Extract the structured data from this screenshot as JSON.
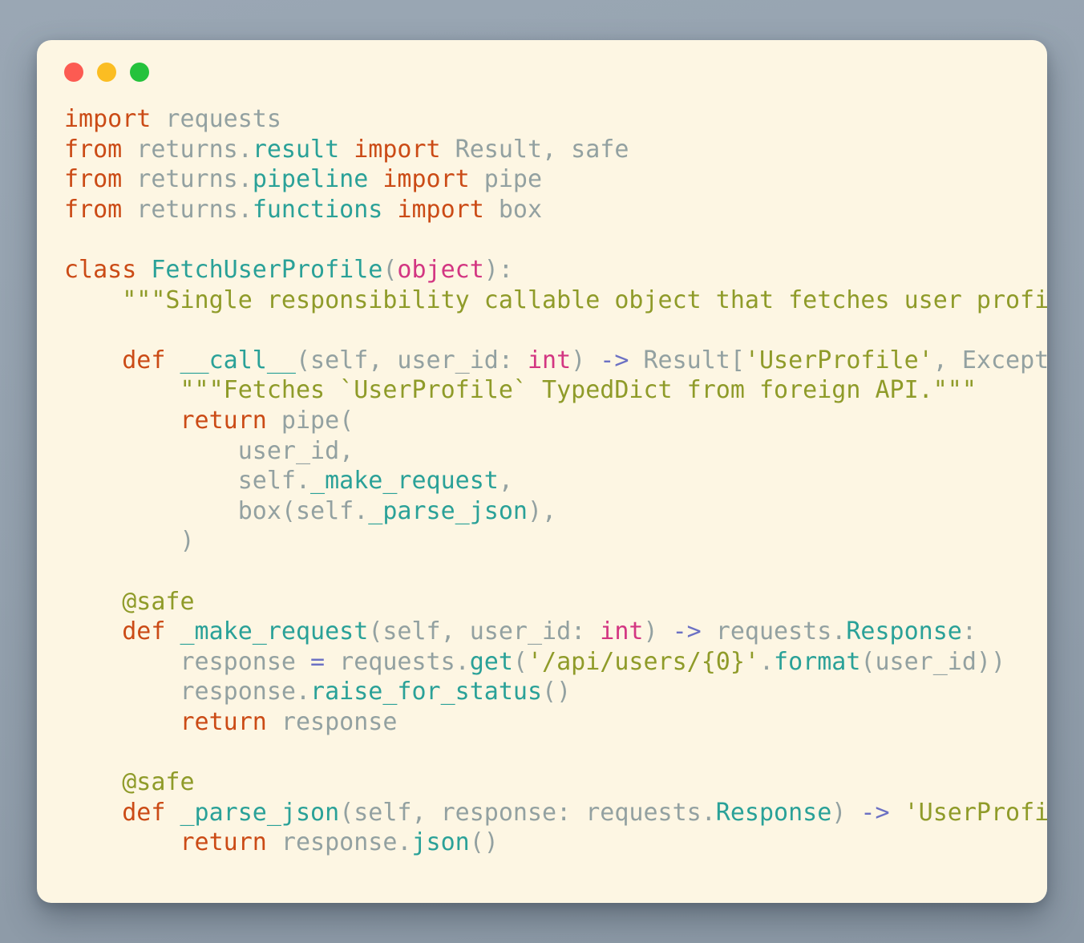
{
  "window": {
    "traffic_lights": [
      {
        "name": "close",
        "color": "#fc5b52"
      },
      {
        "name": "minimize",
        "color": "#fbbd22"
      },
      {
        "name": "zoom",
        "color": "#24c23c"
      }
    ],
    "background_color": "#fdf6e3",
    "desktop_color": "#96a3b0"
  },
  "code": {
    "language": "python",
    "theme": "solarized-light",
    "lines": [
      [
        {
          "t": "import",
          "c": "kw"
        },
        {
          "t": " requests",
          "c": "pl"
        }
      ],
      [
        {
          "t": "from",
          "c": "kw"
        },
        {
          "t": " returns.",
          "c": "pl"
        },
        {
          "t": "result",
          "c": "cls"
        },
        {
          "t": " ",
          "c": "pl"
        },
        {
          "t": "import",
          "c": "kw"
        },
        {
          "t": " Result, safe",
          "c": "pl"
        }
      ],
      [
        {
          "t": "from",
          "c": "kw"
        },
        {
          "t": " returns.",
          "c": "pl"
        },
        {
          "t": "pipeline",
          "c": "cls"
        },
        {
          "t": " ",
          "c": "pl"
        },
        {
          "t": "import",
          "c": "kw"
        },
        {
          "t": " pipe",
          "c": "pl"
        }
      ],
      [
        {
          "t": "from",
          "c": "kw"
        },
        {
          "t": " returns.",
          "c": "pl"
        },
        {
          "t": "functions",
          "c": "cls"
        },
        {
          "t": " ",
          "c": "pl"
        },
        {
          "t": "import",
          "c": "kw"
        },
        {
          "t": " box",
          "c": "pl"
        }
      ],
      [],
      [
        {
          "t": "class",
          "c": "kw"
        },
        {
          "t": " ",
          "c": "pl"
        },
        {
          "t": "FetchUserProfile",
          "c": "cls"
        },
        {
          "t": "(",
          "c": "pl"
        },
        {
          "t": "object",
          "c": "bi"
        },
        {
          "t": "):",
          "c": "pl"
        }
      ],
      [
        {
          "t": "    \"\"\"Single responsibility callable object that fetches user profile.\"\"\"",
          "c": "str"
        }
      ],
      [],
      [
        {
          "t": "    ",
          "c": "pl"
        },
        {
          "t": "def",
          "c": "kw"
        },
        {
          "t": " ",
          "c": "pl"
        },
        {
          "t": "__call__",
          "c": "cls"
        },
        {
          "t": "(self, user_id: ",
          "c": "pl"
        },
        {
          "t": "int",
          "c": "bi"
        },
        {
          "t": ") ",
          "c": "pl"
        },
        {
          "t": "->",
          "c": "op"
        },
        {
          "t": " Result[",
          "c": "pl"
        },
        {
          "t": "'UserProfile'",
          "c": "str"
        },
        {
          "t": ", Exception]:",
          "c": "pl"
        }
      ],
      [
        {
          "t": "        \"\"\"Fetches `UserProfile` TypedDict from foreign API.\"\"\"",
          "c": "str"
        }
      ],
      [
        {
          "t": "        ",
          "c": "pl"
        },
        {
          "t": "return",
          "c": "kw"
        },
        {
          "t": " pipe(",
          "c": "pl"
        }
      ],
      [
        {
          "t": "            user_id,",
          "c": "pl"
        }
      ],
      [
        {
          "t": "            self.",
          "c": "pl"
        },
        {
          "t": "_make_request",
          "c": "cls"
        },
        {
          "t": ",",
          "c": "pl"
        }
      ],
      [
        {
          "t": "            box(self.",
          "c": "pl"
        },
        {
          "t": "_parse_json",
          "c": "cls"
        },
        {
          "t": "),",
          "c": "pl"
        }
      ],
      [
        {
          "t": "        )",
          "c": "pl"
        }
      ],
      [],
      [
        {
          "t": "    @safe",
          "c": "str"
        }
      ],
      [
        {
          "t": "    ",
          "c": "pl"
        },
        {
          "t": "def",
          "c": "kw"
        },
        {
          "t": " ",
          "c": "pl"
        },
        {
          "t": "_make_request",
          "c": "cls"
        },
        {
          "t": "(self, user_id: ",
          "c": "pl"
        },
        {
          "t": "int",
          "c": "bi"
        },
        {
          "t": ") ",
          "c": "pl"
        },
        {
          "t": "->",
          "c": "op"
        },
        {
          "t": " requests.",
          "c": "pl"
        },
        {
          "t": "Response",
          "c": "cls"
        },
        {
          "t": ":",
          "c": "pl"
        }
      ],
      [
        {
          "t": "        response ",
          "c": "pl"
        },
        {
          "t": "=",
          "c": "op"
        },
        {
          "t": " requests.",
          "c": "pl"
        },
        {
          "t": "get",
          "c": "cls"
        },
        {
          "t": "(",
          "c": "pl"
        },
        {
          "t": "'/api/users/{0}'",
          "c": "str"
        },
        {
          "t": ".",
          "c": "pl"
        },
        {
          "t": "format",
          "c": "cls"
        },
        {
          "t": "(user_id))",
          "c": "pl"
        }
      ],
      [
        {
          "t": "        response.",
          "c": "pl"
        },
        {
          "t": "raise_for_status",
          "c": "cls"
        },
        {
          "t": "()",
          "c": "pl"
        }
      ],
      [
        {
          "t": "        ",
          "c": "pl"
        },
        {
          "t": "return",
          "c": "kw"
        },
        {
          "t": " response",
          "c": "pl"
        }
      ],
      [],
      [
        {
          "t": "    @safe",
          "c": "str"
        }
      ],
      [
        {
          "t": "    ",
          "c": "pl"
        },
        {
          "t": "def",
          "c": "kw"
        },
        {
          "t": " ",
          "c": "pl"
        },
        {
          "t": "_parse_json",
          "c": "cls"
        },
        {
          "t": "(self, response: requests.",
          "c": "pl"
        },
        {
          "t": "Response",
          "c": "cls"
        },
        {
          "t": ") ",
          "c": "pl"
        },
        {
          "t": "->",
          "c": "op"
        },
        {
          "t": " ",
          "c": "pl"
        },
        {
          "t": "'UserProfile'",
          "c": "str"
        },
        {
          "t": ":",
          "c": "pl"
        }
      ],
      [
        {
          "t": "        ",
          "c": "pl"
        },
        {
          "t": "return",
          "c": "kw"
        },
        {
          "t": " response.",
          "c": "pl"
        },
        {
          "t": "json",
          "c": "cls"
        },
        {
          "t": "()",
          "c": "pl"
        }
      ]
    ]
  }
}
